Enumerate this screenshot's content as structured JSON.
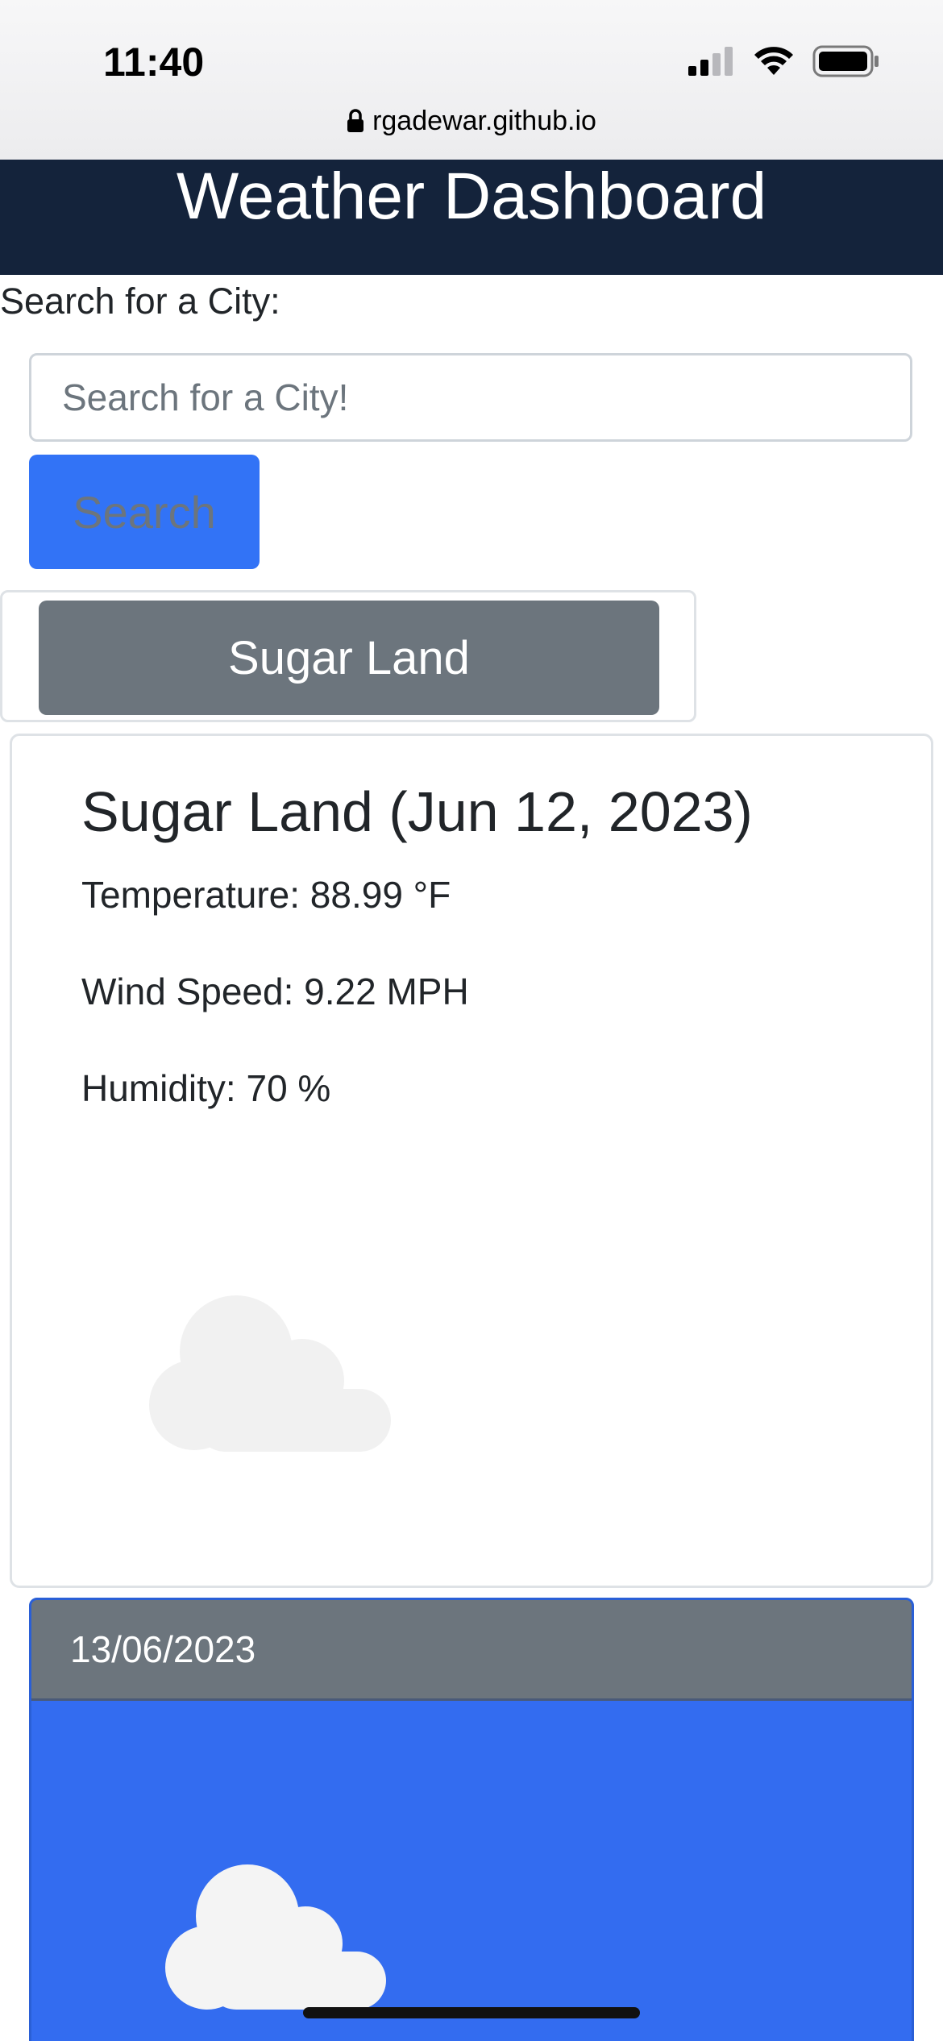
{
  "status_bar": {
    "time": "11:40",
    "icons": [
      "cellular-signal-icon",
      "wifi-icon",
      "battery-icon"
    ]
  },
  "browser": {
    "url": "rgadewar.github.io",
    "lock_icon": "lock-icon"
  },
  "header": {
    "title": "Weather Dashboard"
  },
  "search": {
    "label": "Search for a City:",
    "placeholder": "Search for a City!",
    "value": "",
    "button_label": "Search"
  },
  "history": {
    "cities": [
      "Sugar Land"
    ]
  },
  "current_weather": {
    "title": "Sugar Land (Jun 12, 2023)",
    "temperature": "Temperature: 88.99 °F",
    "wind_speed": "Wind Speed: 9.22 MPH",
    "humidity": "Humidity: 70 %",
    "icon": "cloud-icon"
  },
  "forecast": [
    {
      "date": "13/06/2023",
      "icon": "cloud-icon"
    }
  ],
  "colors": {
    "header_bg": "#14233b",
    "primary": "#3273f6",
    "secondary": "#6c757d",
    "forecast_bg": "#336cf0"
  }
}
